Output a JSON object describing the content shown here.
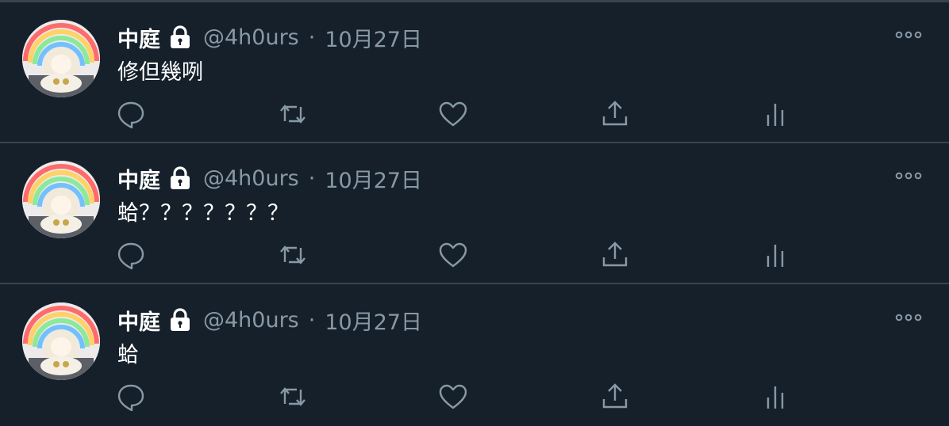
{
  "tweets": [
    {
      "name": "中庭",
      "handle": "@4h0urs",
      "separator": "·",
      "date": "10月27日",
      "text": "修但幾咧"
    },
    {
      "name": "中庭",
      "handle": "@4h0urs",
      "separator": "·",
      "date": "10月27日",
      "text": "蛤？？？？？？？"
    },
    {
      "name": "中庭",
      "handle": "@4h0urs",
      "separator": "·",
      "date": "10月27日",
      "text": "蛤"
    }
  ],
  "icons": {
    "protected": "lock-icon",
    "more": "more-icon",
    "reply": "reply-icon",
    "retweet": "retweet-icon",
    "like": "like-icon",
    "share": "share-icon",
    "analytics": "analytics-icon"
  },
  "colors": {
    "background": "#15202b",
    "divider": "#38444d",
    "primary_text": "#ffffff",
    "secondary_text": "#8899a6"
  }
}
